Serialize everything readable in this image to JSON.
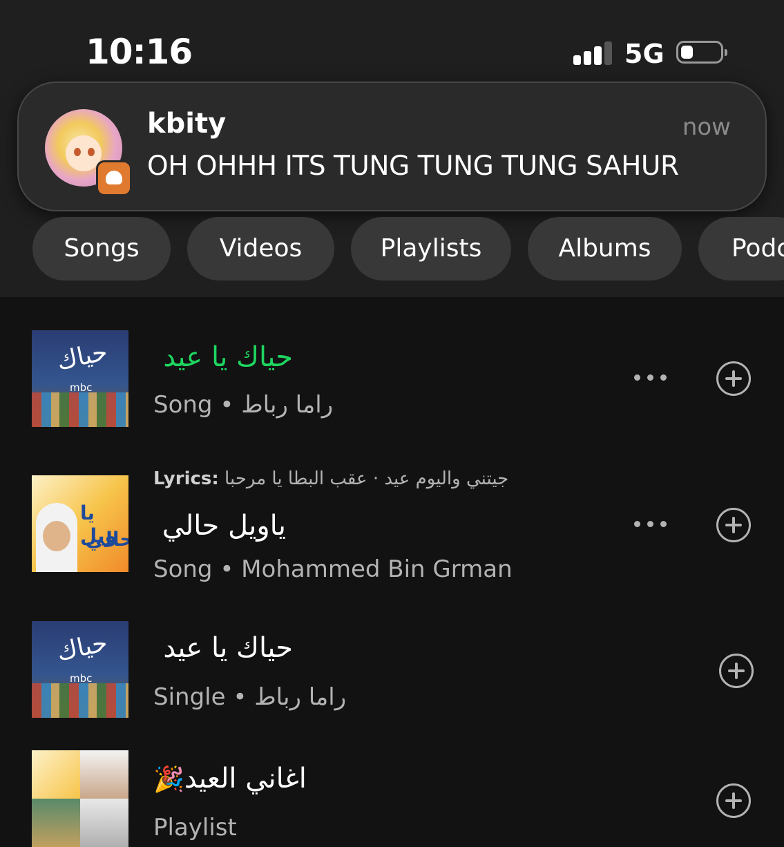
{
  "status_bar": {
    "time": "10:16",
    "network": "5G"
  },
  "notification": {
    "sender": "kbity",
    "time": "now",
    "message": "OH OHHH ITS TUNG TUNG TUNG SAHUR"
  },
  "filters": [
    "Songs",
    "Videos",
    "Playlists",
    "Albums",
    "Podc"
  ],
  "results": [
    {
      "title": "حياك يا عيد",
      "subtitle": "Song • راما رباط",
      "title_color": "#1ed760",
      "artwork_icon": "album-art-hayak-ya-eid"
    },
    {
      "lyrics_prefix": "Lyrics:",
      "lyrics_text": "جيتني واليوم عيد · عقب البطا يا مرحبا",
      "title": "ياويل حالي",
      "subtitle": "Song • Mohammed Bin Grman",
      "artwork_icon": "album-art-yaweel-hali",
      "artwork_text_1": "يا ويل",
      "artwork_text_2": "حالي"
    },
    {
      "title": "حياك يا عيد",
      "subtitle": "Single • راما رباط",
      "artwork_icon": "album-art-hayak-ya-eid"
    },
    {
      "title": "اغاني العيد",
      "emoji": "🎉",
      "subtitle": "Playlist",
      "artwork_icon": "playlist-collage"
    }
  ],
  "artwork_text": {
    "calligraphy": "حياك",
    "mbc": "mbc"
  },
  "colors": {
    "background": "#121212",
    "header_background": "#1f1f1f",
    "accent_green": "#1ed760",
    "chip": "#383838",
    "secondary_text": "#b3b3b3"
  }
}
